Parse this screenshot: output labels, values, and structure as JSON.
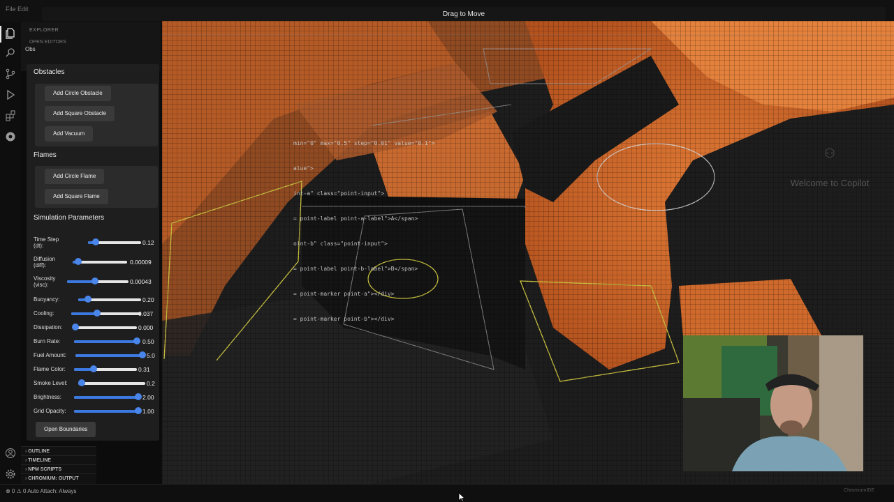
{
  "window": {
    "drag_label": "Drag to Move",
    "menu": "File  Edit"
  },
  "explorer": {
    "title": "EXPLORER",
    "open_editors": "OPEN EDITORS",
    "obs": "Obs"
  },
  "activity_icons": [
    "files-icon",
    "search-icon",
    "source-control-icon",
    "run-debug-icon",
    "extensions-icon",
    "chrome-icon"
  ],
  "sections": {
    "obstacles": {
      "title": "Obstacles",
      "buttons": [
        "Add Circle Obstacle",
        "Add Square Obstacle",
        "Add Vacuum"
      ]
    },
    "flames": {
      "title": "Flames",
      "buttons": [
        "Add Circle Flame",
        "Add Square Flame"
      ]
    },
    "simulation": {
      "title": "Simulation Parameters"
    }
  },
  "params": [
    {
      "label": "Time Step (dt):",
      "value": "0.12",
      "fill": 0.15
    },
    {
      "label": "Diffusion (diff):",
      "value": "0.00009",
      "fill": 0.1
    },
    {
      "label": "Viscosity (visc):",
      "value": "0.00043",
      "fill": 0.45
    },
    {
      "label": "Buoyancy:",
      "value": "0.20",
      "fill": 0.15
    },
    {
      "label": "Cooling:",
      "value": "0.037",
      "fill": 0.37
    },
    {
      "label": "Dissipation:",
      "value": "0.000",
      "fill": 0.0
    },
    {
      "label": "Burn Rate:",
      "value": "0.50",
      "fill": 1.0
    },
    {
      "label": "Fuel Amount:",
      "value": "5.0",
      "fill": 1.0
    },
    {
      "label": "Flame Color:",
      "value": "0.31",
      "fill": 0.31
    },
    {
      "label": "Smoke Level:",
      "value": "0.2",
      "fill": 0.05
    },
    {
      "label": "Brightness:",
      "value": "2.00",
      "fill": 1.0
    },
    {
      "label": "Grid Opacity:",
      "value": "1.00",
      "fill": 1.0
    }
  ],
  "open_boundaries": "Open Boundaries",
  "panels_footer": [
    "OUTLINE",
    "TIMELINE",
    "NPM SCRIPTS",
    "CHROMIUM: OUTPUT DIRECT..."
  ],
  "status": {
    "left": "⊗ 0 ⚠ 0   Auto Attach: Always",
    "right": "ChromiumIDE"
  },
  "code_overlay": [
    "min=\"0\" max=\"0.5\" step=\"0.01\" value=\"0.1\">",
    "alue\">",
    "int-a\" class=\"point-input\">",
    "= point-label point-a-label\">A</span>",
    "oint-b\" class=\"point-input\">",
    "= point-label point-b-label\">B</span>",
    "= point-marker point-a\"></div>",
    "= point-marker point-b\"></div>"
  ],
  "copilot": {
    "title": "Welcome to Copilot"
  },
  "colors": {
    "accent": "#3b78e0",
    "flame": "#d9692a",
    "outline": "#c8c040"
  }
}
